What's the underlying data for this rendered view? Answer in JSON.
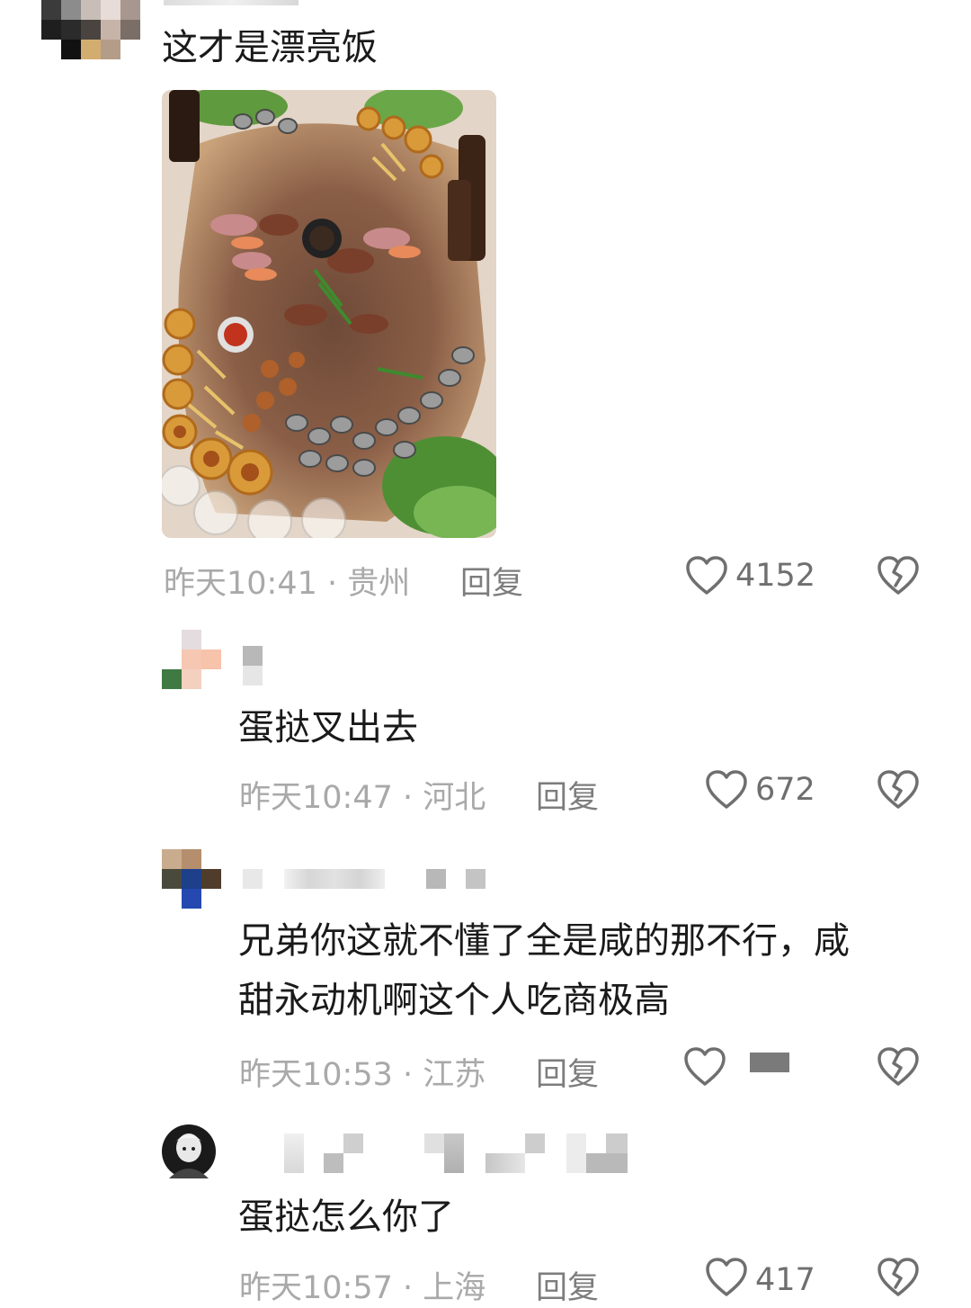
{
  "comments": [
    {
      "text": "这才是漂亮饭",
      "time": "昨天10:41 · 贵州",
      "reply": "回复",
      "likes": "4152"
    },
    {
      "text": "蛋挞叉出去",
      "time": "昨天10:47 · 河北",
      "reply": "回复",
      "likes": "672"
    },
    {
      "text": "兄弟你这就不懂了全是咸的那不行，咸\n甜永动机啊这个人吃商极高",
      "time": "昨天10:53 · 江苏",
      "reply": "回复",
      "likes": ""
    },
    {
      "text": "蛋挞怎么你了",
      "time": "昨天10:57 · 上海",
      "reply": "回复",
      "likes": "417"
    }
  ],
  "icons": {
    "like": "heart-outline-icon",
    "dislike": "broken-heart-icon"
  },
  "colors": {
    "meta_text": "#a9a9a9",
    "reply_text": "#7d7d7d",
    "icon_stroke": "#6f6f6f"
  }
}
